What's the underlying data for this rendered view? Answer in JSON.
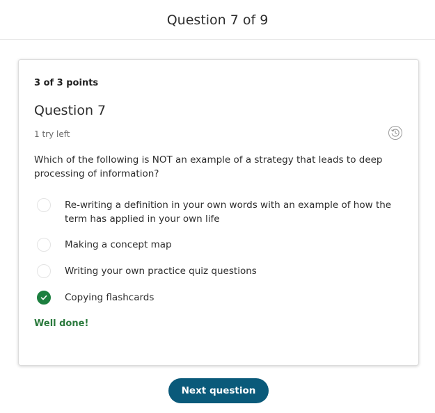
{
  "header": {
    "title": "Question 7 of 9"
  },
  "card": {
    "points": "3 of 3 points",
    "question_title": "Question 7",
    "tries_left": "1 try left",
    "history_icon": "history-icon",
    "prompt": "Which of the following is NOT an example of a strategy that leads to deep processing of information?",
    "options": [
      {
        "label": "Re-writing a definition in your own words with an example of how the term has applied in your own life",
        "selected": false
      },
      {
        "label": "Making a concept map",
        "selected": false
      },
      {
        "label": "Writing your own practice quiz questions",
        "selected": false
      },
      {
        "label": "Copying flashcards",
        "selected": true
      }
    ],
    "feedback": "Well done!"
  },
  "footer": {
    "next_label": "Next question"
  },
  "colors": {
    "correct_green": "#1c7f3f",
    "feedback_green": "#2b7a3d",
    "button_blue": "#0a5a7a"
  }
}
